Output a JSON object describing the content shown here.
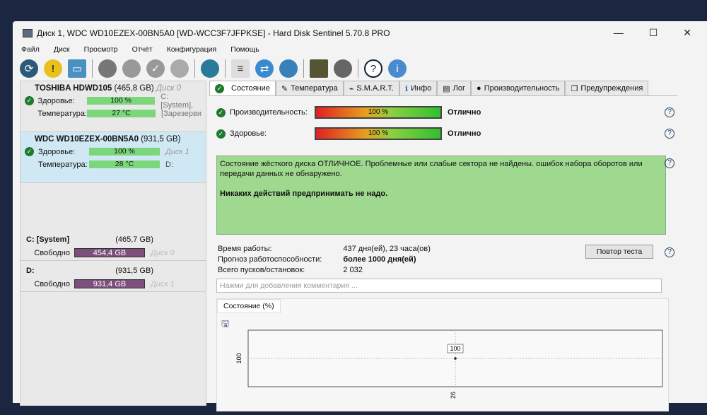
{
  "window": {
    "title": "Диск 1, WDC WD10EZEX-00BN5A0 [WD-WCC3F7JFPKSE]  -  Hard Disk Sentinel 5.70.8 PRO",
    "controls": [
      "—",
      "☐",
      "✕"
    ]
  },
  "menu": [
    "Файл",
    "Диск",
    "Просмотр",
    "Отчёт",
    "Конфигурация",
    "Помощь"
  ],
  "disks": [
    {
      "name": "TOSHIBA HDWD105",
      "size": "(465,8 GB)",
      "disk": "Диск 0",
      "health_label": "Здоровье:",
      "health": "100 %",
      "temp_label": "Температура:",
      "temp": "27 °C",
      "vol1": "C: [System],",
      "vol2": "[Зарезерви"
    },
    {
      "name": "WDC WD10EZEX-00BN5A0",
      "size": "(931,5 GB)",
      "disk": "Диск 1",
      "health_label": "Здоровье:",
      "health": "100 %",
      "temp_label": "Температура:",
      "temp": "28 °C",
      "vol1": "",
      "vol2": "D:"
    }
  ],
  "partitions": [
    {
      "name": "C: [System]",
      "size": "(465,7 GB)",
      "free_label": "Свободно",
      "free": "454,4 GB",
      "disk": "Диск 0"
    },
    {
      "name": "D:",
      "size": "(931,5 GB)",
      "free_label": "Свободно",
      "free": "931,4 GB",
      "disk": "Диск 1"
    }
  ],
  "tabs": [
    "Состояние",
    "Температура",
    "S.M.A.R.T.",
    "Инфо",
    "Лог",
    "Производительность",
    "Предупреждения"
  ],
  "meters": [
    {
      "label": "Производительность:",
      "value": "100 %",
      "percent": 100,
      "rating": "Отлично"
    },
    {
      "label": "Здоровье:",
      "value": "100 %",
      "percent": 100,
      "rating": "Отлично"
    }
  ],
  "status": {
    "line1": "Состояние жёсткого диска ОТЛИЧНОЕ. Проблемные или слабые сектора не найдены. ошибок набора оборотов или передачи данных не обнаружено.",
    "line2": "Никаких действий предпринимать не надо."
  },
  "info": [
    {
      "k": "Время работы:",
      "v": "437 дня(ей), 23 часа(ов)"
    },
    {
      "k": "Прогноз работоспособности:",
      "v": "более 1000 дня(ей)"
    },
    {
      "k": "Всего пусков/остановок:",
      "v": "2 032"
    }
  ],
  "retest": "Повтор теста",
  "comment_placeholder": "Нажми для добавления комментария ...",
  "chart_data": {
    "type": "line",
    "title": "Состояние (%)",
    "x": [
      "26"
    ],
    "values": [
      100
    ],
    "point_label": "100",
    "ytick": "100",
    "xtick": "26"
  }
}
